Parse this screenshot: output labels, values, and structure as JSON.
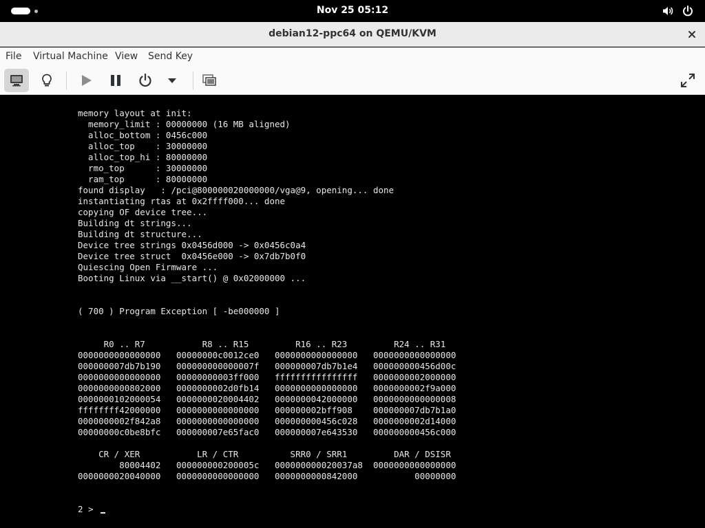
{
  "topbar": {
    "clock": "Nov 25  05:12",
    "icons": [
      "activities-indicator",
      "volume-icon",
      "power-icon"
    ]
  },
  "window": {
    "title": "debian12-ppc64 on QEMU/KVM",
    "close_icon": "close-icon"
  },
  "menubar": {
    "items": [
      "File",
      "Virtual Machine",
      "View",
      "Send Key"
    ]
  },
  "toolbar": {
    "buttons": [
      {
        "name": "console-button",
        "icon": "monitor-icon",
        "active": true
      },
      {
        "name": "details-button",
        "icon": "lightbulb-icon"
      },
      {
        "name": "run-button",
        "icon": "play-icon"
      },
      {
        "name": "pause-button",
        "icon": "pause-icon"
      },
      {
        "name": "shutdown-button",
        "icon": "power-icon"
      },
      {
        "name": "shutdown-menu-button",
        "icon": "caret-down-icon"
      },
      {
        "name": "snapshots-button",
        "icon": "snapshots-icon"
      },
      {
        "name": "fullscreen-button",
        "icon": "resize-icon"
      }
    ]
  },
  "console": {
    "lines": [
      "memory layout at init:",
      "  memory_limit : 00000000 (16 MB aligned)",
      "  alloc_bottom : 0456c000",
      "  alloc_top    : 30000000",
      "  alloc_top_hi : 80000000",
      "  rmo_top      : 30000000",
      "  ram_top      : 80000000",
      "found display   : /pci@800000020000000/vga@9, opening... done",
      "instantiating rtas at 0x2ffff000... done",
      "copying OF device tree...",
      "Building dt strings...",
      "Building dt structure...",
      "Device tree strings 0x0456d000 -> 0x0456c0a4",
      "Device tree struct  0x0456e000 -> 0x7db7b0f0",
      "Quiescing Open Firmware ...",
      "Booting Linux via __start() @ 0x02000000 ...",
      "",
      "",
      "( 700 ) Program Exception [ -be000000 ]",
      "",
      "",
      "     R0 .. R7           R8 .. R15         R16 .. R23         R24 .. R31",
      "0000000000000000   00000000c0012ce0   0000000000000000   0000000000000000",
      "000000007db7b190   000000000000007f   000000007db7b1e4   000000000456d00c",
      "0000000000000000   00000000003ff000   ffffffffffffffff   0000000002000000",
      "0000000000802000   0000000002d0fb14   0000000000000000   0000000002f9a000",
      "0000000102000054   0000000020004402   0000000042000000   0000000000000008",
      "ffffffff42000000   0000000000000000   000000002bff908    000000007db7b1a0",
      "0000000002f842a8   0000000000000000   000000000456c028   0000000002d14000",
      "00000000c0be8bfc   000000007e65fac0   000000007e643530   000000000456c000",
      "",
      "    CR / XER           LR / CTR          SRR0 / SRR1         DAR / DSISR",
      "        80004402   000000000200005c   000000000020037a8  0000000000000000",
      "0000000020040000   0000000000000000   0000000000842000           00000000",
      "",
      "",
      "2 > "
    ]
  }
}
